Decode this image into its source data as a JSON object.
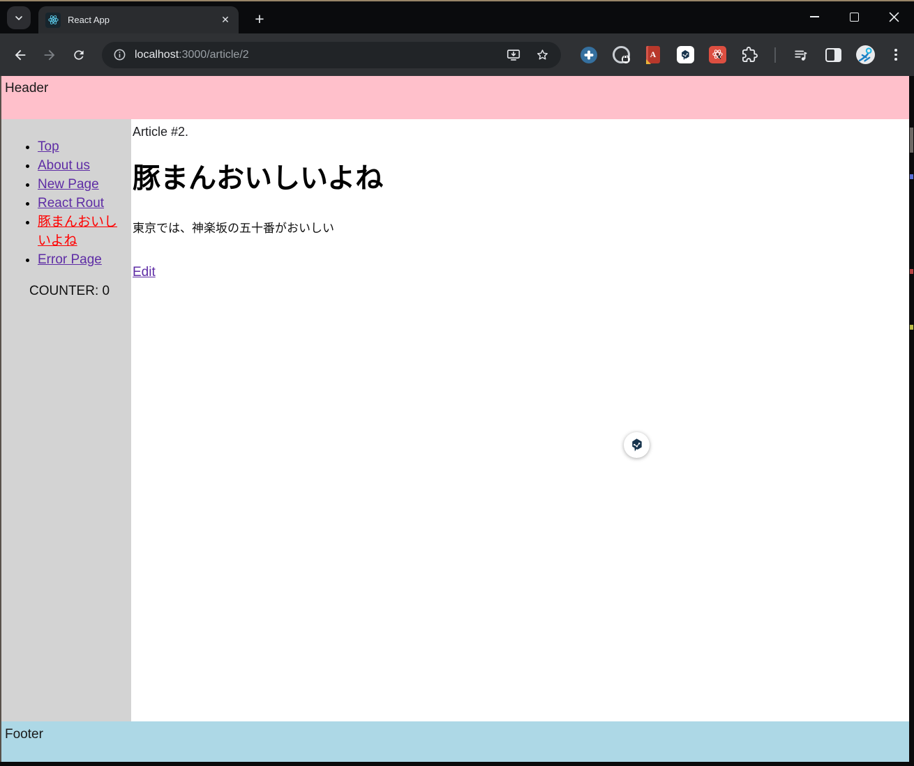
{
  "browser": {
    "tab": {
      "title": "React App"
    },
    "url": {
      "host": "localhost",
      "path": ":3000/article/2"
    }
  },
  "page": {
    "header_label": "Header",
    "footer_label": "Footer",
    "sidebar": {
      "items": [
        {
          "label": "Top"
        },
        {
          "label": "About us"
        },
        {
          "label": "New Page"
        },
        {
          "label": "React Rout"
        },
        {
          "label": "豚まんおいしいよね",
          "active": true
        },
        {
          "label": "Error Page"
        }
      ],
      "counter_label": "COUNTER: 0"
    },
    "article": {
      "eyebrow": "Article #2.",
      "title": "豚まんおいしいよね",
      "body": "東京では、神楽坂の五十番がおいしい",
      "edit_label": "Edit"
    }
  },
  "colors": {
    "header_bg": "#ffc0cb",
    "sidebar_bg": "#d3d3d3",
    "footer_bg": "#add8e6",
    "link": "#5e2ca5",
    "active_link": "#ff0000",
    "react_accent": "#61dafb",
    "badge_navy": "#17344d"
  }
}
